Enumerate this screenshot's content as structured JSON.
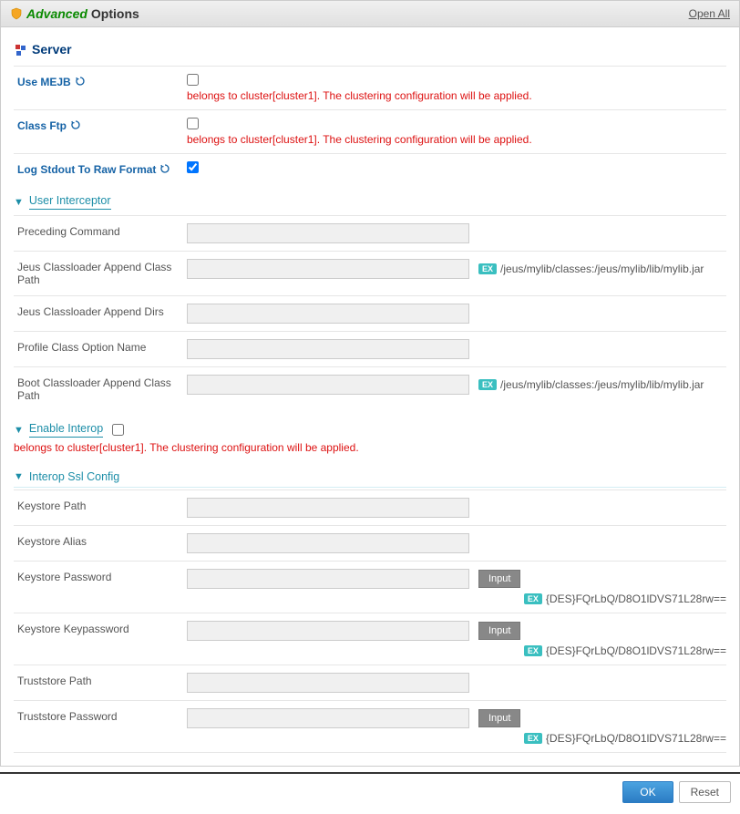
{
  "header": {
    "advanced": "Advanced",
    "options": "Options",
    "open_all": "Open All"
  },
  "server": {
    "title": "Server",
    "cluster_note": "belongs to cluster[cluster1]. The clustering configuration will be applied.",
    "use_mejb_label": "Use MEJB",
    "class_ftp_label": "Class Ftp",
    "log_stdout_label": "Log Stdout To Raw Format"
  },
  "user_interceptor": {
    "title": "User Interceptor",
    "preceding_command": "Preceding Command",
    "jeus_append_class_path": "Jeus Classloader Append Class Path",
    "jeus_append_dirs": "Jeus Classloader Append Dirs",
    "profile_class_option": "Profile Class Option Name",
    "boot_append_class_path": "Boot Classloader Append Class Path",
    "ex_path": "/jeus/mylib/classes:/jeus/mylib/lib/mylib.jar"
  },
  "enable_interop": {
    "title": "Enable Interop",
    "cluster_note": "belongs to cluster[cluster1]. The clustering configuration will be applied."
  },
  "interop_ssl": {
    "title": "Interop Ssl Config",
    "keystore_path": "Keystore Path",
    "keystore_alias": "Keystore Alias",
    "keystore_password": "Keystore Password",
    "keystore_keypassword": "Keystore Keypassword",
    "truststore_path": "Truststore Path",
    "truststore_password": "Truststore Password",
    "input_btn": "Input",
    "ex_value": "{DES}FQrLbQ/D8O1lDVS71L28rw=="
  },
  "misc": {
    "ex_tag": "EX"
  },
  "footer": {
    "ok": "OK",
    "reset": "Reset"
  }
}
